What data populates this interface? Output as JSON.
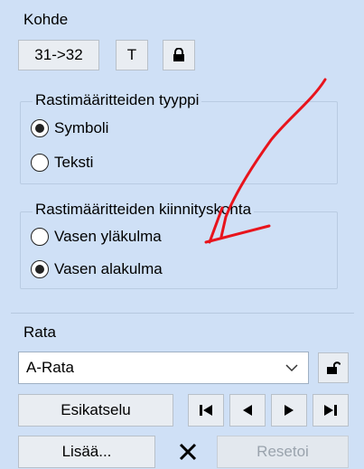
{
  "kohde": {
    "title": "Kohde",
    "range_button": "31->32",
    "t_button": "T"
  },
  "type_group": {
    "title": "Rastimääritteiden tyyppi",
    "options": [
      {
        "label": "Symboli",
        "selected": true
      },
      {
        "label": "Teksti",
        "selected": false
      }
    ]
  },
  "anchor_group": {
    "title": "Rastimääritteiden kiinnityskohta",
    "options": [
      {
        "label": "Vasen yläkulma",
        "selected": false
      },
      {
        "label": "Vasen alakulma",
        "selected": true
      }
    ]
  },
  "rata": {
    "title": "Rata",
    "selected_course": "A-Rata",
    "preview_button": "Esikatselu",
    "add_button": "Lisää...",
    "reset_button": "Resetoi"
  },
  "colors": {
    "background": "#cfe0f6",
    "annotation_arrow": "#e8141c",
    "disabled_text": "#9aa3ad"
  },
  "icons": [
    "lock-icon",
    "unlock-icon",
    "first-icon",
    "previous-icon",
    "next-icon",
    "last-icon",
    "delete-x-icon",
    "chevron-down-icon"
  ]
}
